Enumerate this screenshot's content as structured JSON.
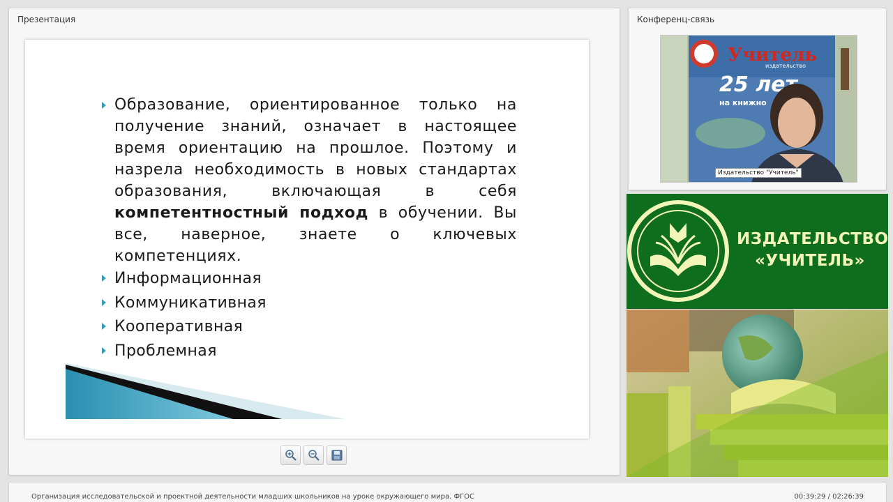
{
  "presentation": {
    "title": "Презентация",
    "slide": {
      "paragraph_start": "Образование, ориентированное только на получение знаний, означает в настоящее время ориентацию на прошлое. Поэтому и назрела необходимость в новых стандартах образования, включающая в себя ",
      "paragraph_bold": "компетентностный подход",
      "paragraph_end": " в обучении. Вы все, наверное, знаете о ключевых компетенциях.",
      "items": [
        "Информационная",
        "Коммуникативная",
        "Кооперативная",
        "Проблемная"
      ]
    },
    "tools": [
      "zoom-in-icon",
      "zoom-out-icon",
      "save-icon"
    ]
  },
  "conference": {
    "title": "Конференц-связь",
    "video_label": "Издательство \"Учитель\"",
    "poster_brand": "Учитель",
    "poster_sub": "издательство",
    "poster_years": "25 лет",
    "poster_line": "на книжно"
  },
  "logo": {
    "line1": "ИЗДАТЕЛЬСТВО",
    "line2": "«УЧИТЕЛЬ»"
  },
  "footer": {
    "title": "Организация исследовательской и проектной деятельности младших школьников на уроке окружающего мира. ФГОС",
    "time": "00:39:29 / 02:26:39"
  },
  "colors": {
    "bullet": "#3a9ab8",
    "logo_green": "#0f6d1e",
    "logo_text": "#f1f5b7"
  }
}
